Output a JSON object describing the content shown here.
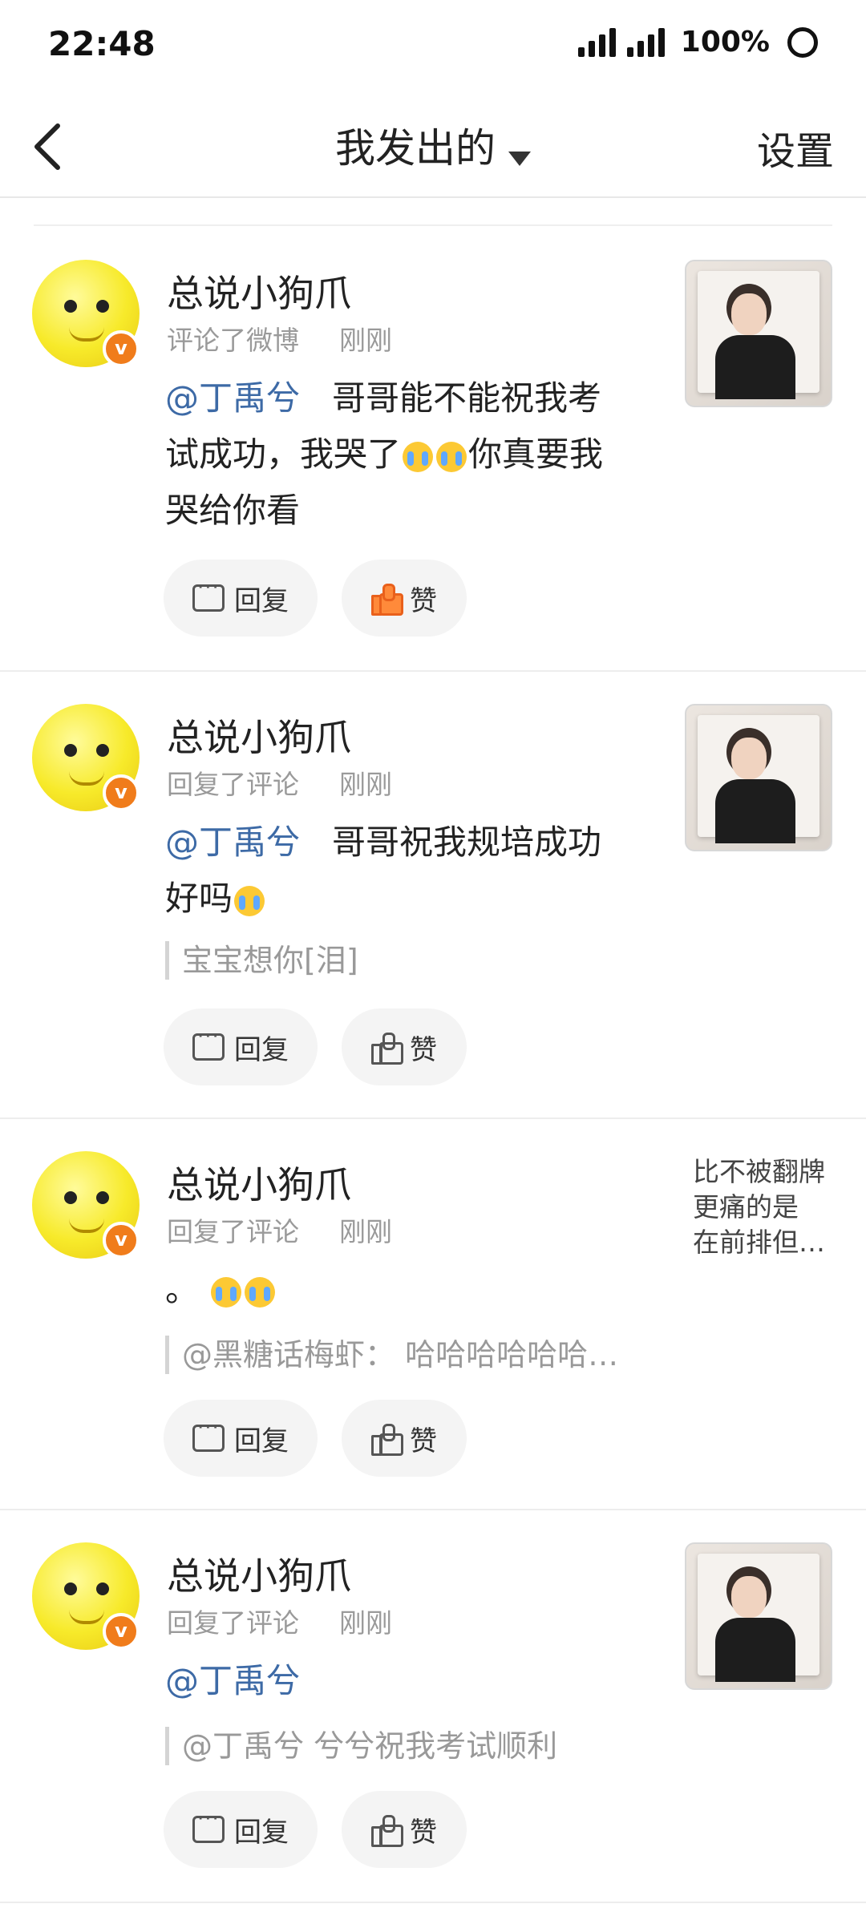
{
  "status_bar": {
    "time": "22:48",
    "battery": "100%"
  },
  "nav": {
    "title": "我发出的",
    "settings": "设置"
  },
  "labels": {
    "reply": "回复",
    "like": "赞"
  },
  "colors": {
    "mention": "#3d6aa6",
    "like_active": "#e9601b",
    "verified_badge": "#f07c1b"
  },
  "feed": [
    {
      "username": "总说小狗爪",
      "action": "评论了微博",
      "time": "刚刚",
      "mention": "@丁禹兮",
      "text_line1": "哥哥能不能祝我考",
      "text_line2a": "试成功，我哭了",
      "text_line2b": "你真要我",
      "text_line3": "哭给你看",
      "liked": true
    },
    {
      "username": "总说小狗爪",
      "action": "回复了评论",
      "time": "刚刚",
      "mention": "@丁禹兮",
      "text_line1": "哥哥祝我规培成功",
      "text_line2": "好吗",
      "quote": "宝宝想你[泪]",
      "liked": false
    },
    {
      "username": "总说小狗爪",
      "action": "回复了评论",
      "time": "刚刚",
      "side_text": [
        "比不被翻牌",
        "更痛的是",
        "在前排但…"
      ],
      "text": "。",
      "quote": "@黑糖话梅虾：  哈哈哈哈哈哈…",
      "liked": false
    },
    {
      "username": "总说小狗爪",
      "action": "回复了评论",
      "time": "刚刚",
      "mention": "@丁禹兮",
      "quote": "@丁禹兮  兮兮祝我考试顺利",
      "liked": false
    }
  ]
}
